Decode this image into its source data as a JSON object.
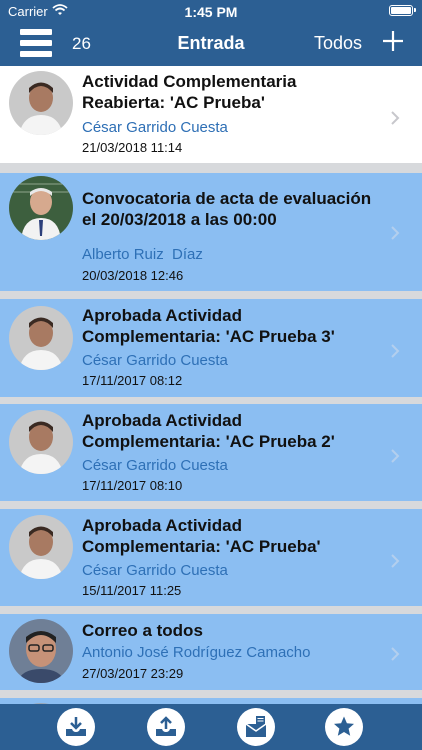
{
  "status_bar": {
    "carrier": "Carrier",
    "time": "1:45 PM"
  },
  "nav": {
    "count": "26",
    "title": "Entrada",
    "filter": "Todos"
  },
  "messages": [
    {
      "subject": "Actividad Complementaria Reabierta: 'AC Prueba'",
      "sender": "César Garrido Cuesta",
      "date": "21/03/2018 11:14",
      "read": true
    },
    {
      "subject": "Convocatoria de acta de evaluación el 20/03/2018 a las 00:00",
      "sender": "Alberto Ruiz  Díaz",
      "date": "20/03/2018 12:46",
      "read": false
    },
    {
      "subject": "Aprobada Actividad Complementaria: 'AC Prueba 3'",
      "sender": "César Garrido Cuesta",
      "date": "17/11/2017 08:12",
      "read": false
    },
    {
      "subject": "Aprobada Actividad Complementaria: 'AC Prueba 2'",
      "sender": "César Garrido Cuesta",
      "date": "17/11/2017 08:10",
      "read": false
    },
    {
      "subject": "Aprobada Actividad Complementaria: 'AC Prueba'",
      "sender": "César Garrido Cuesta",
      "date": "15/11/2017 11:25",
      "read": false
    },
    {
      "subject": "Correo a todos",
      "sender": "Antonio José Rodríguez Camacho",
      "date": "27/03/2017 23:29",
      "read": false
    }
  ],
  "colors": {
    "nav": "#2c5f93",
    "unread_row": "#8bbef2",
    "sender_text": "#2e6fb5"
  },
  "tab_bar": {
    "icons": [
      "inbox-download-icon",
      "upload-icon",
      "mail-icon",
      "star-icon"
    ]
  }
}
